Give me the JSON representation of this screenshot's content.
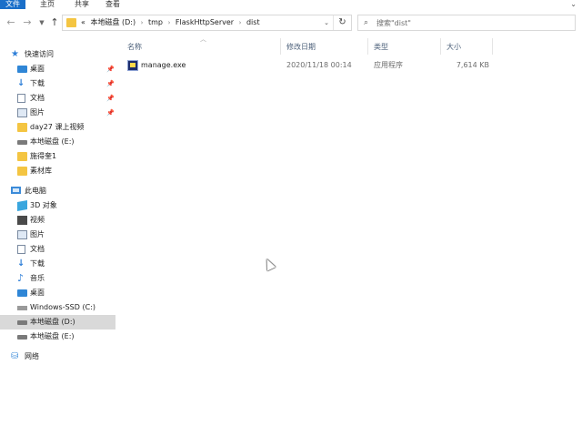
{
  "ribbon": {
    "file_tab": "文件",
    "tabs": [
      "主页",
      "共享",
      "查看"
    ],
    "expand_glyph": "⌄"
  },
  "address_bar": {
    "overflow": "«",
    "crumbs": [
      "本地磁盘 (D:)",
      "tmp",
      "FlaskHttpServer",
      "dist"
    ],
    "separator": "›"
  },
  "search": {
    "placeholder": "搜索\"dist\""
  },
  "sidebar": {
    "quick_access": "快速访问",
    "quick_items": [
      {
        "label": "桌面",
        "icon": "desktop-icon",
        "pinned": true
      },
      {
        "label": "下载",
        "icon": "download-icon",
        "pinned": true
      },
      {
        "label": "文档",
        "icon": "document-icon",
        "pinned": true
      },
      {
        "label": "图片",
        "icon": "pictures-icon",
        "pinned": true
      },
      {
        "label": "day27 课上视频",
        "icon": "folder-icon",
        "pinned": false
      },
      {
        "label": "本地磁盘 (E:)",
        "icon": "drive-icon",
        "pinned": false
      },
      {
        "label": "施得奎1",
        "icon": "folder-icon",
        "pinned": false
      },
      {
        "label": "素材库",
        "icon": "folder-icon",
        "pinned": false
      }
    ],
    "this_pc": "此电脑",
    "pc_items": [
      {
        "label": "3D 对象",
        "icon": "3d-objects-icon"
      },
      {
        "label": "视频",
        "icon": "videos-icon"
      },
      {
        "label": "图片",
        "icon": "pictures-icon"
      },
      {
        "label": "文档",
        "icon": "document-icon"
      },
      {
        "label": "下载",
        "icon": "download-icon"
      },
      {
        "label": "音乐",
        "icon": "music-icon"
      },
      {
        "label": "桌面",
        "icon": "desktop-icon"
      },
      {
        "label": "Windows-SSD (C:)",
        "icon": "drive-icon"
      },
      {
        "label": "本地磁盘 (D:)",
        "icon": "drive-icon",
        "selected": true
      },
      {
        "label": "本地磁盘 (E:)",
        "icon": "drive-icon"
      }
    ],
    "network": "网络"
  },
  "list": {
    "columns": {
      "name": "名称",
      "date": "修改日期",
      "type": "类型",
      "size": "大小"
    },
    "files": [
      {
        "name": "manage.exe",
        "date": "2020/11/18 00:14",
        "type": "应用程序",
        "size": "7,614 KB",
        "icon": "exe-icon"
      }
    ]
  },
  "colors": {
    "accent": "#1a6fc9",
    "selected_bg": "#d9d9d9",
    "header_text": "#4c607a"
  }
}
